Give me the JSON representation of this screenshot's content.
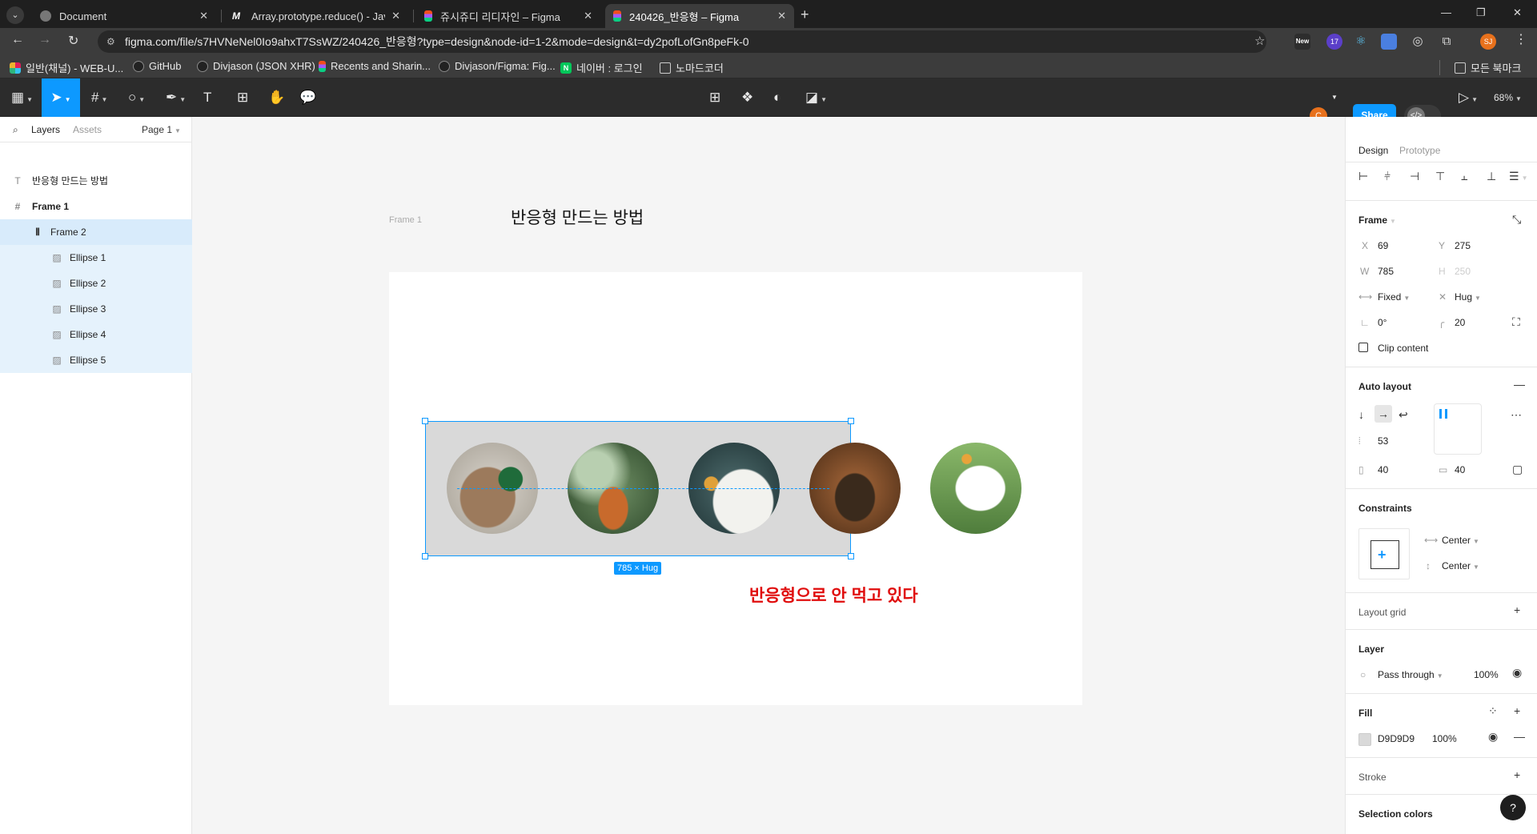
{
  "browser": {
    "tabs": [
      {
        "title": "Document",
        "favicon": "globe-icon"
      },
      {
        "title": "Array.prototype.reduce() - Java",
        "favicon": "mdn-icon"
      },
      {
        "title": "쥬시쥬디 리디자인 – Figma",
        "favicon": "figma-icon"
      },
      {
        "title": "240426_반응형 – Figma",
        "favicon": "figma-icon"
      }
    ],
    "url": "figma.com/file/s7HVNeNel0Io9ahxT7SsWZ/240426_반응형?type=design&node-id=1-2&mode=design&t=dy2pofLofGn8peFk-0",
    "extension_badge": "17",
    "extension_new": "New",
    "profile_initials": "SJ",
    "bookmarks": [
      "일반(채널) - WEB-U...",
      "GitHub",
      "Divjason (JSON XHR)",
      "Recents and Sharin...",
      "Divjason/Figma: Fig...",
      "네이버 : 로그인",
      "노마드코더"
    ],
    "all_bookmarks": "모든 북마크"
  },
  "figma_toolbar": {
    "avatar_initial": "C",
    "share_label": "Share",
    "zoom": "68%"
  },
  "left_panel": {
    "tabs": {
      "layers": "Layers",
      "assets": "Assets"
    },
    "page": "Page 1",
    "layers": [
      {
        "name": "반응형 만드는 방법",
        "icon": "text-icon",
        "indent": 0
      },
      {
        "name": "Frame 1",
        "icon": "frame-icon",
        "indent": 0
      },
      {
        "name": "Frame 2",
        "icon": "auto-layout-icon",
        "indent": 1
      },
      {
        "name": "Ellipse 1",
        "icon": "image-icon",
        "indent": 2
      },
      {
        "name": "Ellipse 2",
        "icon": "image-icon",
        "indent": 2
      },
      {
        "name": "Ellipse 3",
        "icon": "image-icon",
        "indent": 2
      },
      {
        "name": "Ellipse 4",
        "icon": "image-icon",
        "indent": 2
      },
      {
        "name": "Ellipse 5",
        "icon": "image-icon",
        "indent": 2
      }
    ]
  },
  "canvas": {
    "title": "반응형 만드는 방법",
    "frame_label": "Frame 1",
    "size_badge": "785 × Hug",
    "note": "반응형으로 안 먹고 있다",
    "note_color": "#e00d0d",
    "frame2_fill": "#d9d9d9",
    "selection_color": "#0d99ff"
  },
  "right_panel": {
    "tabs": {
      "design": "Design",
      "prototype": "Prototype"
    },
    "frame_section": "Frame",
    "x_label": "X",
    "x": "69",
    "y_label": "Y",
    "y": "275",
    "w_label": "W",
    "w": "785",
    "h_label": "H",
    "h": "250",
    "width_mode": "Fixed",
    "height_mode": "Hug",
    "rotation": "0°",
    "radius": "20",
    "clip_content": "Clip content",
    "auto_layout": "Auto layout",
    "gap": "53",
    "padding_h": "40",
    "padding_v": "40",
    "constraints": "Constraints",
    "constraint_h": "Center",
    "constraint_v": "Center",
    "layout_grid": "Layout grid",
    "layer": "Layer",
    "blend": "Pass through",
    "opacity": "100%",
    "fill": "Fill",
    "fill_hex": "D9D9D9",
    "fill_opacity": "100%",
    "stroke": "Stroke",
    "selection_colors": "Selection colors"
  }
}
